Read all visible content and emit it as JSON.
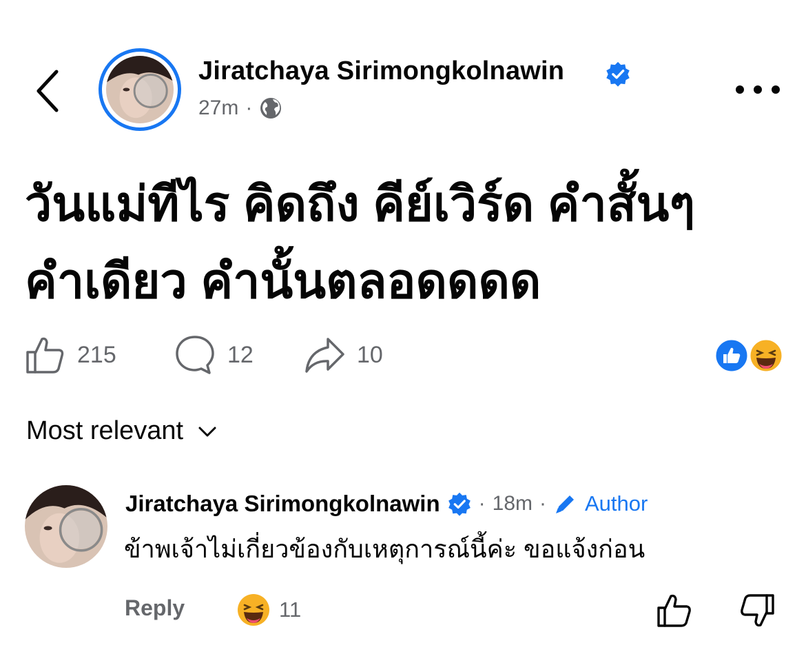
{
  "post": {
    "author_name": "Jiratchaya Sirimongkolnawin",
    "time": "27m",
    "separator": "·",
    "audience_icon": "globe-icon",
    "text_line1": "วันแม่ทีไร คิดถึง คีย์เวิร์ด คำสั้นๆ",
    "text_line2": "คำเดียว คำนั้นตลอดดดด"
  },
  "actions": {
    "like_count": "215",
    "comment_count": "12",
    "share_count": "10"
  },
  "reactions": [
    "like",
    "haha"
  ],
  "sort": {
    "label": "Most relevant"
  },
  "comment": {
    "author_name": "Jiratchaya Sirimongkolnawin",
    "dot1": "·",
    "time": "18m",
    "dot2": "·",
    "author_tag": "Author",
    "text": "ข้าพเจ้าไม่เกี่ยวข้องกับเหตุการณ์นี้ค่ะ ขอแจ้งก่อน",
    "reply_label": "Reply",
    "reaction_count": "11"
  },
  "colors": {
    "accent": "#1877f2",
    "secondary_text": "#65676b",
    "primary_text": "#050505",
    "haha_yellow": "#f7b125"
  }
}
